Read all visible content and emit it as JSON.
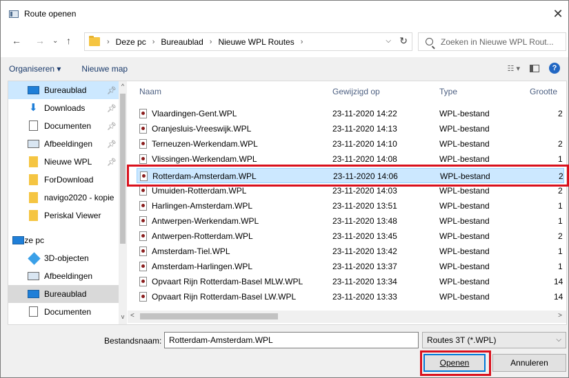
{
  "window": {
    "title": "Route openen",
    "close": "✕"
  },
  "address": {
    "crumbs": [
      "Deze pc",
      "Bureaublad",
      "Nieuwe WPL Routes"
    ],
    "search_placeholder": "Zoeken in Nieuwe WPL Rout..."
  },
  "toolbar": {
    "organize": "Organiseren ▾",
    "new_folder": "Nieuwe map"
  },
  "nav": {
    "items": [
      {
        "label": "Bureaublad",
        "icon": "desktop-icon"
      },
      {
        "label": "Downloads",
        "icon": "download-icon"
      },
      {
        "label": "Documenten",
        "icon": "document-icon"
      },
      {
        "label": "Afbeeldingen",
        "icon": "pictures-icon"
      },
      {
        "label": "Nieuwe WPL",
        "icon": "folder-icon"
      },
      {
        "label": "ForDownload",
        "icon": "folder-icon"
      },
      {
        "label": "navigo2020 - kopie",
        "icon": "folder-icon"
      },
      {
        "label": "Periskal Viewer",
        "icon": "folder-icon"
      },
      {
        "label": "Deze pc",
        "icon": "computer-icon"
      },
      {
        "label": "3D-objecten",
        "icon": "cube-icon"
      },
      {
        "label": "Afbeeldingen",
        "icon": "pictures-icon"
      },
      {
        "label": "Bureaublad",
        "icon": "desktop-icon"
      },
      {
        "label": "Documenten",
        "icon": "document-icon"
      }
    ]
  },
  "columns": {
    "name": "Naam",
    "modified": "Gewijzigd op",
    "type": "Type",
    "size": "Grootte"
  },
  "files": [
    {
      "name": "Vlaardingen-Gent.WPL",
      "date": "23-11-2020 14:22",
      "type": "WPL-bestand",
      "size": "2"
    },
    {
      "name": "Oranjesluis-Vreeswijk.WPL",
      "date": "23-11-2020 14:13",
      "type": "WPL-bestand",
      "size": ""
    },
    {
      "name": "Terneuzen-Werkendam.WPL",
      "date": "23-11-2020 14:10",
      "type": "WPL-bestand",
      "size": "2"
    },
    {
      "name": "Vlissingen-Werkendam.WPL",
      "date": "23-11-2020 14:08",
      "type": "WPL-bestand",
      "size": "1"
    },
    {
      "name": "Rotterdam-Amsterdam.WPL",
      "date": "23-11-2020 14:06",
      "type": "WPL-bestand",
      "size": "2"
    },
    {
      "name": "Umuiden-Rotterdam.WPL",
      "date": "23-11-2020 14:03",
      "type": "WPL-bestand",
      "size": "2"
    },
    {
      "name": "Harlingen-Amsterdam.WPL",
      "date": "23-11-2020 13:51",
      "type": "WPL-bestand",
      "size": "1"
    },
    {
      "name": "Antwerpen-Werkendam.WPL",
      "date": "23-11-2020 13:48",
      "type": "WPL-bestand",
      "size": "1"
    },
    {
      "name": "Antwerpen-Rotterdam.WPL",
      "date": "23-11-2020 13:45",
      "type": "WPL-bestand",
      "size": "2"
    },
    {
      "name": "Amsterdam-Tiel.WPL",
      "date": "23-11-2020 13:42",
      "type": "WPL-bestand",
      "size": "1"
    },
    {
      "name": "Amsterdam-Harlingen.WPL",
      "date": "23-11-2020 13:37",
      "type": "WPL-bestand",
      "size": "1"
    },
    {
      "name": "Opvaart Rijn Rotterdam-Basel MLW.WPL",
      "date": "23-11-2020 13:34",
      "type": "WPL-bestand",
      "size": "14"
    },
    {
      "name": "Opvaart Rijn Rotterdam-Basel LW.WPL",
      "date": "23-11-2020 13:33",
      "type": "WPL-bestand",
      "size": "14"
    }
  ],
  "footer": {
    "filename_label": "Bestandsnaam:",
    "filename_value": "Rotterdam-Amsterdam.WPL",
    "filter": "Routes 3T (*.WPL)",
    "open": "Openen",
    "cancel": "Annuleren"
  },
  "colors": {
    "selection": "#cce8ff",
    "highlight_box": "#d9101c",
    "accent": "#0078d7"
  }
}
